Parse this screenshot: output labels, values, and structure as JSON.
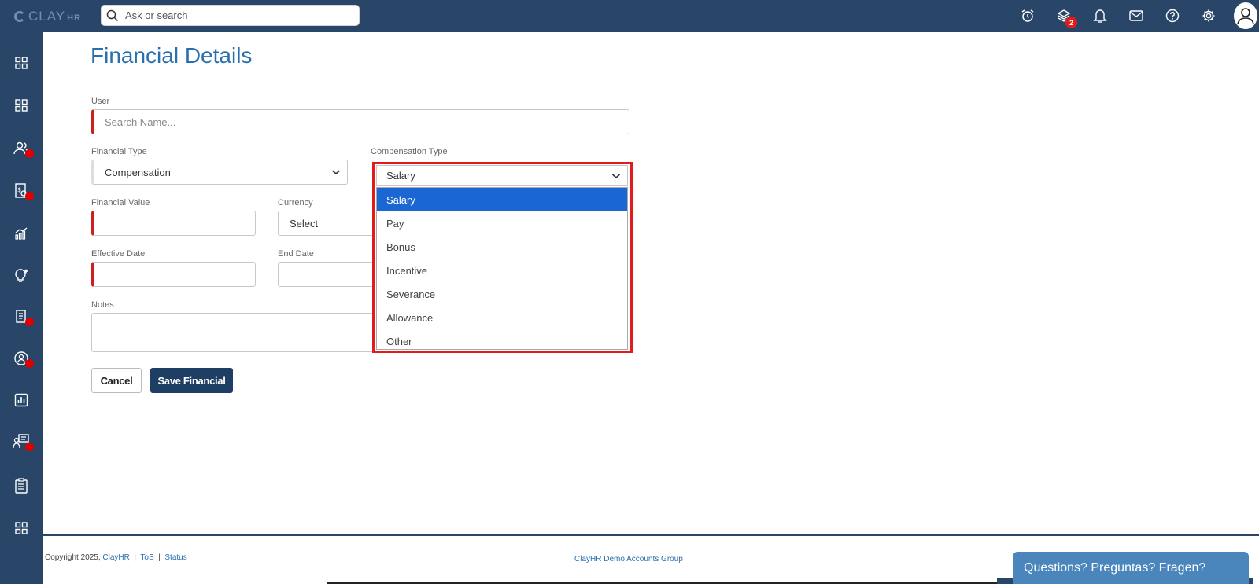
{
  "app": {
    "logo_text": "CLAY",
    "logo_suffix": "HR"
  },
  "search": {
    "placeholder": "Ask or search"
  },
  "top_icons": [
    {
      "name": "alarm-clock-icon"
    },
    {
      "name": "layers-icon",
      "badge": "2"
    },
    {
      "name": "bell-icon"
    },
    {
      "name": "mail-icon"
    },
    {
      "name": "help-icon"
    },
    {
      "name": "gear-icon"
    },
    {
      "name": "user-avatar-icon"
    }
  ],
  "sidebar": {
    "items": [
      {
        "name": "dashboard-grid-icon",
        "dot": false
      },
      {
        "name": "apps-grid-icon",
        "dot": false
      },
      {
        "name": "people-icon",
        "dot": true
      },
      {
        "name": "payroll-icon",
        "dot": true
      },
      {
        "name": "analytics-icon",
        "dot": false
      },
      {
        "name": "lightbulb-icon",
        "dot": false
      },
      {
        "name": "documents-icon",
        "dot": true
      },
      {
        "name": "profile-icon",
        "dot": true
      },
      {
        "name": "reports-icon",
        "dot": false
      },
      {
        "name": "training-icon",
        "dot": true
      },
      {
        "name": "checklist-icon",
        "dot": false
      },
      {
        "name": "more-grid-icon",
        "dot": false
      }
    ]
  },
  "page": {
    "title": "Financial Details"
  },
  "form": {
    "user_label": "User",
    "user_placeholder": "Search Name...",
    "financial_type_label": "Financial Type",
    "financial_type_value": "Compensation",
    "compensation_type_label": "Compensation Type",
    "compensation_type_value": "Salary",
    "financial_value_label": "Financial Value",
    "financial_value_value": "",
    "currency_label": "Currency",
    "currency_value": "Select",
    "effective_date_label": "Effective Date",
    "effective_date_value": "",
    "end_date_label": "End Date",
    "end_date_value": "",
    "notes_label": "Notes",
    "notes_value": "",
    "cancel_label": "Cancel",
    "save_label": "Save Financial"
  },
  "dropdown": {
    "selected": "Salary",
    "options": [
      "Salary",
      "Pay",
      "Bonus",
      "Incentive",
      "Severance",
      "Allowance",
      "Other"
    ]
  },
  "footer": {
    "copyright": "Copyright 2025,",
    "company_link": "ClayHR",
    "separator": "|",
    "tos": "ToS",
    "status": "Status",
    "group": "ClayHR Demo Accounts Group"
  },
  "chat": {
    "label": "Questions? Preguntas? Fragen?"
  },
  "colors": {
    "nav_bg": "#294669",
    "accent": "#2a6fad",
    "primary_button": "#1f3e63",
    "highlight_red": "#e21b1b",
    "selected_option": "#1a66d2"
  }
}
